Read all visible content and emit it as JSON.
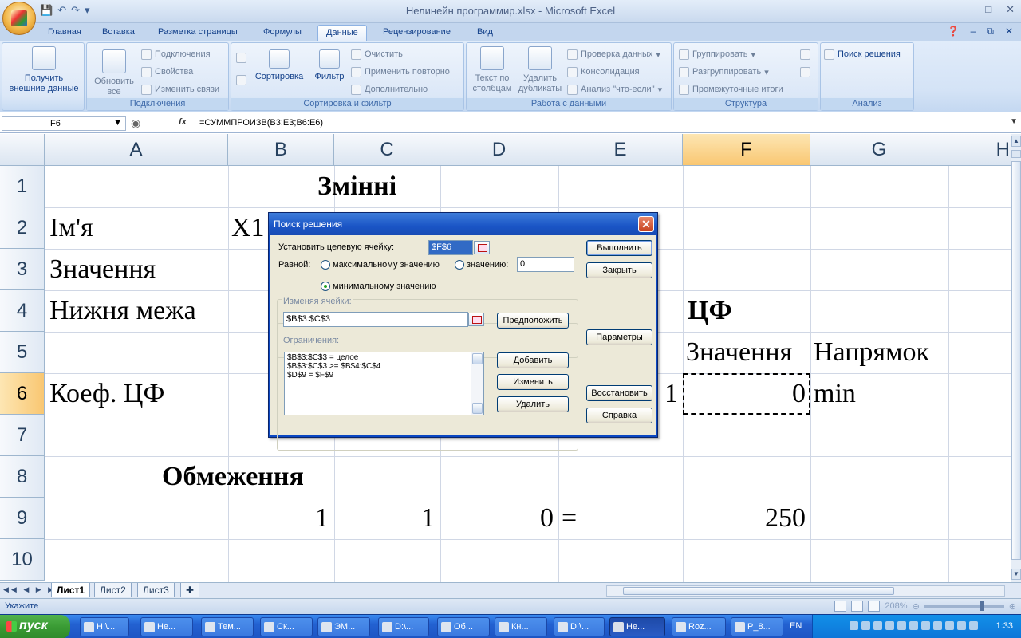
{
  "window": {
    "title": "Нелинейн программир.xlsx - Microsoft Excel",
    "minimize_icon": "minimize-icon",
    "maximize_icon": "maximize-icon",
    "close_icon": "close-icon"
  },
  "qat": {
    "save": "save-icon",
    "undo": "undo-icon",
    "redo": "redo-icon"
  },
  "tabs": [
    "Главная",
    "Вставка",
    "Разметка страницы",
    "Формулы",
    "Данные",
    "Рецензирование",
    "Вид"
  ],
  "active_tab": "Данные",
  "ribbon": {
    "get_external": {
      "line1": "Получить",
      "line2": "внешние данные"
    },
    "refresh": {
      "line1": "Обновить",
      "line2": "все"
    },
    "connections_items": [
      "Подключения",
      "Свойства",
      "Изменить связи"
    ],
    "connections_label": "Подключения",
    "sort_label": "Сортировка",
    "filter_label": "Фильтр",
    "filter_items": [
      "Очистить",
      "Применить повторно",
      "Дополнительно"
    ],
    "sortfilter_label": "Сортировка и фильтр",
    "text_to_columns": {
      "line1": "Текст по",
      "line2": "столбцам"
    },
    "remove_dup": {
      "line1": "Удалить",
      "line2": "дубликаты"
    },
    "data_items": [
      "Проверка данных",
      "Консолидация",
      "Анализ \"что-если\""
    ],
    "data_tools_label": "Работа с данными",
    "outline_items": [
      "Группировать",
      "Разгруппировать",
      "Промежуточные итоги"
    ],
    "outline_label": "Структура",
    "solver": "Поиск решения",
    "analysis_label": "Анализ"
  },
  "formula_bar": {
    "name_box": "F6",
    "fx": "fx",
    "formula": "=СУММПРОИЗВ(B3:E3;B6:E6)"
  },
  "columns": [
    "A",
    "B",
    "C",
    "D",
    "E",
    "F",
    "G",
    "H"
  ],
  "rows": [
    "1",
    "2",
    "3",
    "4",
    "5",
    "6",
    "7",
    "8",
    "9",
    "10"
  ],
  "cells": {
    "B1": "Змінні",
    "A2": "Ім'я",
    "B2": "X1",
    "A3": "Значення",
    "A4": "Нижня межа",
    "F4": "ЦФ",
    "F5": "Значення",
    "G5": "Напрямок",
    "A6": "Коеф. ЦФ",
    "E6": "1",
    "F6": "0",
    "G6": "min",
    "A8": "Обмеження",
    "B9": "1",
    "C9": "1",
    "D9": "0",
    "E9": "=",
    "F9": "250"
  },
  "sheets": [
    "Лист1",
    "Лист2",
    "Лист3"
  ],
  "active_sheet": "Лист1",
  "status": {
    "mode": "Укажите",
    "zoom": "208%"
  },
  "solver_dialog": {
    "title": "Поиск решения",
    "target_label": "Установить целевую ячейку:",
    "target_value": "$F$6",
    "equal_label": "Равной:",
    "opt_max": "максимальному значению",
    "opt_value": "значению:",
    "value_input": "0",
    "opt_min": "минимальному значению",
    "selected": "min",
    "changing_label": "Изменяя ячейки:",
    "changing_value": "$B$3:$C$3",
    "guess_btn": "Предположить",
    "constraints_label": "Ограничения:",
    "constraints": [
      "$B$3:$C$3 = целое",
      "$B$3:$C$3 >= $B$4:$C$4",
      "$D$9 = $F$9"
    ],
    "add_btn": "Добавить",
    "change_btn": "Изменить",
    "delete_btn": "Удалить",
    "solve_btn": "Выполнить",
    "close_btn": "Закрыть",
    "options_btn": "Параметры",
    "reset_btn": "Восстановить",
    "help_btn": "Справка"
  },
  "taskbar": {
    "start": "пуск",
    "tasks": [
      "H:\\...",
      "Не...",
      "Тем...",
      "Ск...",
      "ЭМ...",
      "D:\\...",
      "Об...",
      "Кн...",
      "D:\\...",
      "Не...",
      "Roz...",
      "P_8..."
    ],
    "active_task": 9,
    "lang": "EN",
    "clock": "1:33"
  }
}
